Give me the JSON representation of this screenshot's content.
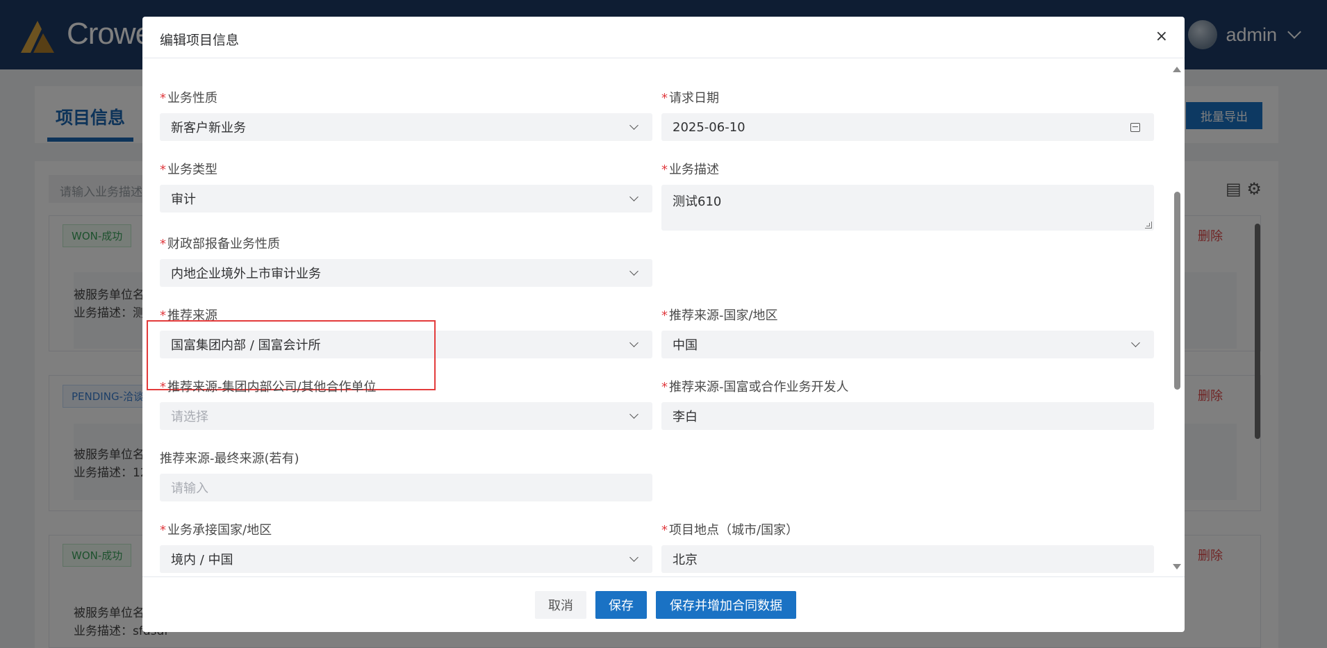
{
  "app": {
    "logo_text": "Crowe",
    "user_name": "admin"
  },
  "background": {
    "tab_title": "项目信息",
    "export_button": "批量导出",
    "search_placeholder": "请输入业务描述",
    "cards": [
      {
        "status": "WON-成功",
        "status_type": "won",
        "line1": "被服务单位名",
        "line2": "业务描述：测",
        "delete_label": "删除"
      },
      {
        "status": "PENDING-洽谈",
        "status_type": "pending",
        "line1": "被服务单位名",
        "line2": "业务描述：12",
        "delete_label": "删除"
      },
      {
        "status": "WON-成功",
        "status_type": "won",
        "line1": "被服务单位名",
        "line2": "业务描述：sfdsdf",
        "delete_label": "删除"
      }
    ]
  },
  "dialog": {
    "title": "编辑项目信息",
    "close_icon": "×",
    "fields": {
      "business_nature": {
        "label": "业务性质",
        "value": "新客户新业务"
      },
      "request_date": {
        "label": "请求日期",
        "value": "2025-06-10"
      },
      "business_type": {
        "label": "业务类型",
        "value": "审计"
      },
      "business_desc": {
        "label": "业务描述",
        "value": "测试610"
      },
      "mof_nature": {
        "label": "财政部报备业务性质",
        "value": "内地企业境外上市审计业务"
      },
      "referral_source": {
        "label": "推荐来源",
        "value": "国富集团内部 / 国富会计所"
      },
      "referral_country": {
        "label": "推荐来源-国家/地区",
        "value": "中国"
      },
      "referral_company": {
        "label": "推荐来源-集团内部公司/其他合作单位",
        "placeholder": "请选择"
      },
      "referral_developer": {
        "label": "推荐来源-国富或合作业务开发人",
        "value": "李白"
      },
      "referral_final": {
        "label": "推荐来源-最终来源(若有)",
        "placeholder": "请输入"
      },
      "service_country": {
        "label": "业务承接国家/地区",
        "value": "境内 / 中国"
      },
      "project_location": {
        "label": "项目地点（城市/国家）",
        "value": "北京"
      }
    },
    "required_mark": "*",
    "buttons": {
      "cancel": "取消",
      "save": "保存",
      "save_add": "保存并增加合同数据"
    }
  },
  "colors": {
    "header_bg": "#1d3a66",
    "primary": "#1a72c4",
    "required": "#e0393e",
    "highlight": "#e33b3b"
  }
}
